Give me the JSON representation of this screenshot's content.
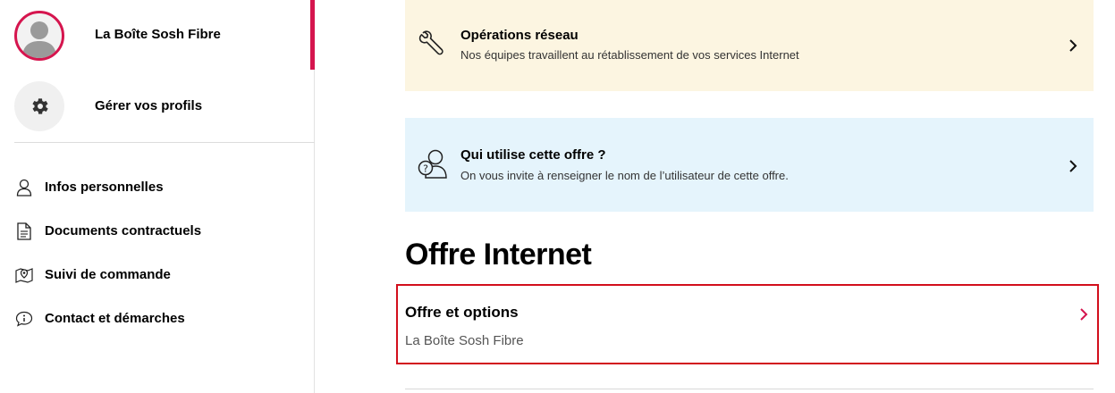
{
  "sidebar": {
    "profile_name": "La Boîte Sosh Fibre",
    "manage_profiles": "Gérer vos profils",
    "nav": [
      {
        "label": "Infos personnelles",
        "icon": "person-icon"
      },
      {
        "label": "Documents contractuels",
        "icon": "document-icon"
      },
      {
        "label": "Suivi de commande",
        "icon": "map-pin-icon"
      },
      {
        "label": "Contact et démarches",
        "icon": "info-bubble-icon"
      }
    ]
  },
  "cards": {
    "network": {
      "title": "Opérations réseau",
      "description": "Nos équipes travaillent au rétablissement de vos services Internet",
      "icon": "wrench-icon"
    },
    "user": {
      "title": "Qui utilise cette offre ?",
      "description": "On vous invite à renseigner le nom de l’utilisateur de cette offre.",
      "icon": "user-question-icon"
    }
  },
  "main": {
    "section_title": "Offre Internet",
    "offer": {
      "title": "Offre et options",
      "subtitle": "La Boîte Sosh Fibre"
    }
  },
  "colors": {
    "accent": "#d5154e",
    "highlight_border": "#d20f1c",
    "network_card_bg": "#fcf5e1",
    "user_card_bg": "#e5f4fc"
  }
}
